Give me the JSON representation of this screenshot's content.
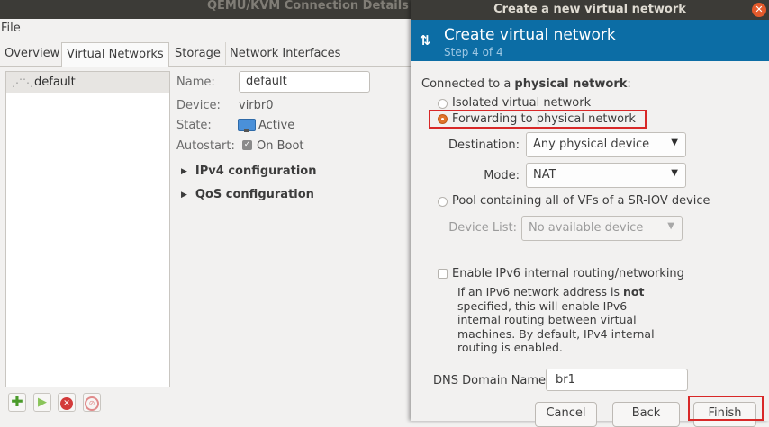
{
  "main_window": {
    "title": "QEMU/KVM Connection Details",
    "menu": {
      "file": "File"
    },
    "tabs": [
      "Overview",
      "Virtual Networks",
      "Storage",
      "Network Interfaces"
    ],
    "networks": [
      {
        "name": "default"
      }
    ],
    "details": {
      "name_label": "Name:",
      "name_value": "default",
      "device_label": "Device:",
      "device_value": "virbr0",
      "state_label": "State:",
      "state_value": "Active",
      "autostart_label": "Autostart:",
      "autostart_value": "On Boot",
      "ipv4_label": "IPv4 configuration",
      "qos_label": "QoS configuration"
    },
    "toolbar_icons": [
      "add-icon",
      "start-icon",
      "stop-icon",
      "delete-icon"
    ]
  },
  "dialog": {
    "title": "Create a new virtual network",
    "header_title": "Create virtual network",
    "step": "Step 4 of 4",
    "connected_prefix": "Connected to a ",
    "connected_bold": "physical network",
    "connected_suffix": ":",
    "radio_isolated": "Isolated virtual network",
    "radio_forwarding": "Forwarding to physical network",
    "destination_label": "Destination:",
    "destination_value": "Any physical device",
    "mode_label": "Mode:",
    "mode_value": "NAT",
    "radio_pool": "Pool containing all of VFs of a SR-IOV device",
    "device_list_label": "Device List:",
    "device_list_value": "No available device",
    "ipv6_checkbox": "Enable IPv6 internal routing/networking",
    "ipv6_desc_prefix": "If an IPv6 network address is ",
    "ipv6_desc_bold": "not",
    "ipv6_desc_rest": "specified, this will enable IPv6 internal routing between virtual machines.  By default, IPv4 internal routing is enabled.",
    "dns_label": "DNS Domain Name:",
    "dns_value": "br1",
    "buttons": {
      "cancel": "Cancel",
      "back": "Back",
      "finish": "Finish"
    }
  },
  "colors": {
    "header_blue": "#0c6da5",
    "highlight_red": "#d82828",
    "titlebar": "#3c3b37",
    "radio_orange": "#e0742c"
  }
}
